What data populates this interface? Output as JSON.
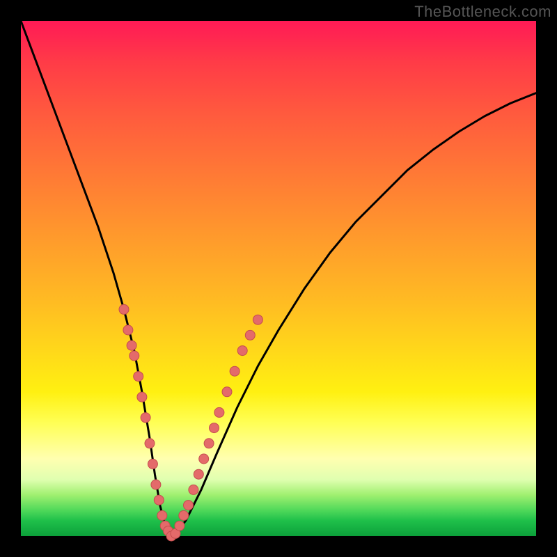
{
  "watermark": "TheBottleneck.com",
  "chart_data": {
    "type": "line",
    "title": "",
    "xlabel": "",
    "ylabel": "",
    "xlim": [
      0,
      100
    ],
    "ylim": [
      0,
      100
    ],
    "grid": false,
    "series": [
      {
        "name": "bottleneck-curve",
        "x": [
          0,
          3,
          6,
          9,
          12,
          15,
          18,
          20,
          22,
          23.5,
          25,
          26,
          27,
          28,
          29,
          30,
          32,
          35,
          38,
          42,
          46,
          50,
          55,
          60,
          65,
          70,
          75,
          80,
          85,
          90,
          95,
          100
        ],
        "y": [
          100,
          92,
          84,
          76,
          68,
          60,
          51,
          44,
          36,
          28,
          19,
          12,
          6,
          2,
          0,
          0.5,
          3,
          9,
          16,
          25,
          33,
          40,
          48,
          55,
          61,
          66,
          71,
          75,
          78.5,
          81.5,
          84,
          86
        ]
      }
    ],
    "markers": [
      {
        "x": 20.0,
        "y": 44
      },
      {
        "x": 20.8,
        "y": 40
      },
      {
        "x": 21.5,
        "y": 37
      },
      {
        "x": 22.0,
        "y": 35
      },
      {
        "x": 22.8,
        "y": 31
      },
      {
        "x": 23.5,
        "y": 27
      },
      {
        "x": 24.2,
        "y": 23
      },
      {
        "x": 25.0,
        "y": 18
      },
      {
        "x": 25.6,
        "y": 14
      },
      {
        "x": 26.2,
        "y": 10
      },
      {
        "x": 26.8,
        "y": 7
      },
      {
        "x": 27.4,
        "y": 4
      },
      {
        "x": 28.0,
        "y": 2
      },
      {
        "x": 28.6,
        "y": 1
      },
      {
        "x": 29.2,
        "y": 0
      },
      {
        "x": 30.0,
        "y": 0.5
      },
      {
        "x": 30.8,
        "y": 2
      },
      {
        "x": 31.6,
        "y": 4
      },
      {
        "x": 32.5,
        "y": 6
      },
      {
        "x": 33.5,
        "y": 9
      },
      {
        "x": 34.5,
        "y": 12
      },
      {
        "x": 35.5,
        "y": 15
      },
      {
        "x": 36.5,
        "y": 18
      },
      {
        "x": 37.5,
        "y": 21
      },
      {
        "x": 38.5,
        "y": 24
      },
      {
        "x": 40.0,
        "y": 28
      },
      {
        "x": 41.5,
        "y": 32
      },
      {
        "x": 43.0,
        "y": 36
      },
      {
        "x": 44.5,
        "y": 39
      },
      {
        "x": 46.0,
        "y": 42
      }
    ],
    "colors": {
      "curve": "#000000",
      "marker_fill": "#e46a6a",
      "marker_stroke": "#c44e4e",
      "gradient_top": "#ff1a56",
      "gradient_bottom": "#0ca03a"
    }
  }
}
